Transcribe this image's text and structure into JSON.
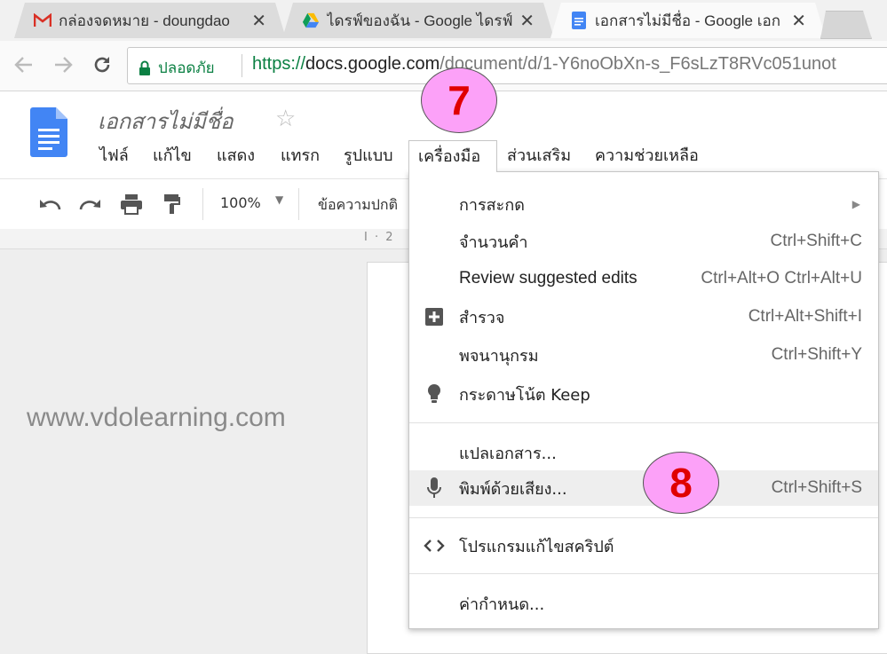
{
  "browser": {
    "tabs": [
      {
        "title": "กล่องจดหมาย - doungdao",
        "icon": "gmail-icon"
      },
      {
        "title": "ไดรฟ์ของฉัน - Google ไดรฟ์",
        "icon": "google-drive-icon"
      },
      {
        "title": "เอกสารไม่มีชื่อ - Google เอก",
        "icon": "google-docs-icon"
      }
    ],
    "active_tab_index": 2,
    "close_glyph": "✕",
    "security_label": "ปลอดภัย",
    "url_scheme": "https://",
    "url_host": "docs.google.com",
    "url_path": "/document/d/1-Y6noObXn-s_F6sLzT8RVc051unot"
  },
  "docs": {
    "title": "เอกสารไม่มีชื่อ",
    "menus": [
      "ไฟล์",
      "แก้ไข",
      "แสดง",
      "แทรก",
      "รูปแบบ",
      "เครื่องมือ",
      "ส่วนเสริม",
      "ความช่วยเหลือ"
    ],
    "open_menu": "เครื่องมือ",
    "zoom": "100%",
    "paragraph_style": "ข้อความปกติ",
    "ruler_text": "I · 2"
  },
  "tools_menu": {
    "items": [
      {
        "label": "การสะกด",
        "shortcut": "",
        "submenu": true,
        "icon": ""
      },
      {
        "label": "จำนวนคำ",
        "shortcut": "Ctrl+Shift+C",
        "icon": ""
      },
      {
        "label": "Review suggested edits",
        "shortcut": "Ctrl+Alt+O Ctrl+Alt+U",
        "icon": ""
      },
      {
        "label": "สำรวจ",
        "shortcut": "Ctrl+Alt+Shift+I",
        "icon": "explore-plus-icon"
      },
      {
        "label": "พจนานุกรม",
        "shortcut": "Ctrl+Shift+Y",
        "icon": ""
      },
      {
        "label": "กระดาษโน้ต Keep",
        "shortcut": "",
        "icon": "lightbulb-icon"
      },
      {
        "label": "แปลเอกสาร...",
        "shortcut": "",
        "icon": ""
      },
      {
        "label": "พิมพ์ด้วยเสียง...",
        "shortcut": "Ctrl+Shift+S",
        "icon": "microphone-icon",
        "highlighted": true
      },
      {
        "label": "โปรแกรมแก้ไขสคริปต์",
        "shortcut": "",
        "icon": "code-brackets-icon"
      },
      {
        "label": "ค่ากำหนด...",
        "shortcut": "",
        "icon": ""
      }
    ]
  },
  "watermark": "www.vdolearning.com",
  "callouts": [
    {
      "label": "7"
    },
    {
      "label": "8"
    }
  ],
  "colors": {
    "callout_fill": "#fca1f8",
    "callout_text": "#e00000",
    "secure_green": "#0b8043",
    "docs_blue": "#4285f4"
  }
}
